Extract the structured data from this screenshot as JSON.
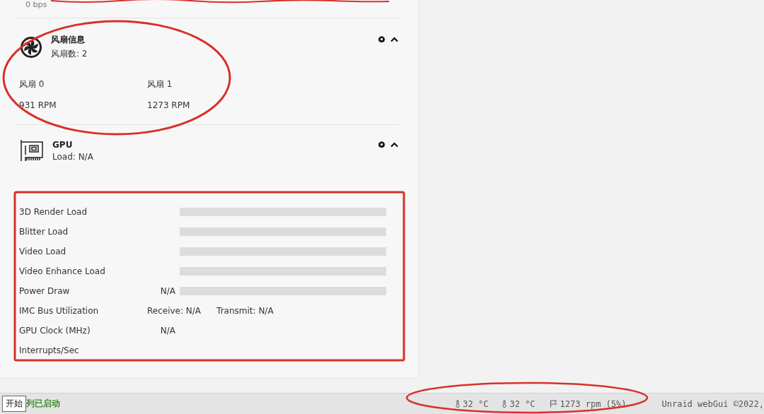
{
  "network": {
    "rate": "0 bps"
  },
  "fan_panel": {
    "title": "风扇信息",
    "subtitle": "风扇数: 2",
    "fans": [
      {
        "name": "风扇 0",
        "speed": "931 RPM"
      },
      {
        "name": "风扇 1",
        "speed": "1273 RPM"
      }
    ]
  },
  "gpu_panel": {
    "title": "GPU",
    "subtitle": "Load: N/A",
    "rows": [
      {
        "kind": "bar",
        "label": "3D Render Load"
      },
      {
        "kind": "bar",
        "label": "Blitter Load"
      },
      {
        "kind": "bar",
        "label": "Video Load"
      },
      {
        "kind": "bar",
        "label": "Video Enhance Load"
      },
      {
        "kind": "bar",
        "label": "Power Draw",
        "value": "N/A"
      },
      {
        "kind": "pair",
        "label": "IMC Bus Utilization",
        "receive": "Receive: N/A",
        "transmit": "Transmit: N/A"
      },
      {
        "kind": "value",
        "label": "GPU Clock (MHz)",
        "value": "N/A"
      },
      {
        "kind": "value",
        "label": "Interrupts/Sec"
      }
    ]
  },
  "status_bar": {
    "start_button": "开始",
    "array_status": "列已启动",
    "temperatures": [
      "32 °C",
      "32 °C"
    ],
    "fan": "1273 rpm (5%)",
    "footer": "Unraid webGui ©2022,"
  }
}
